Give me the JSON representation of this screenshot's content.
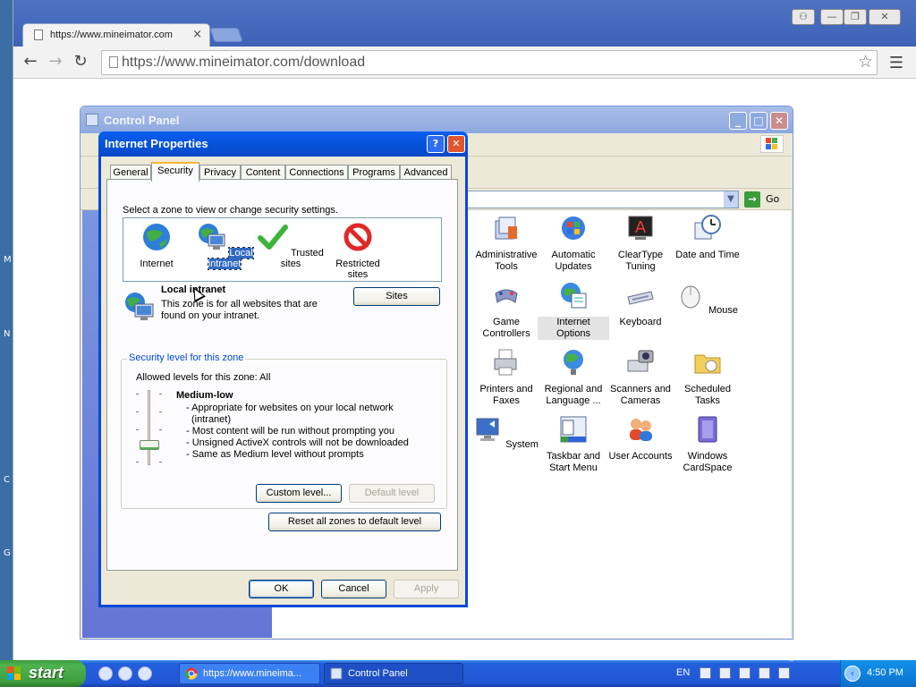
{
  "desktop": {
    "edge_labels": [
      "M",
      "N",
      "C",
      "G"
    ]
  },
  "browser": {
    "tab_title": "https://www.mineimator.com",
    "tab_close": "×",
    "url": "https://www.mineimator.com/download",
    "window_controls": [
      "⚇",
      "—",
      "❐",
      "✕"
    ]
  },
  "control_panel": {
    "title": "Control Panel",
    "address_go": "Go",
    "items": [
      {
        "label": "Administrative Tools",
        "icon": "admin-tools-icon"
      },
      {
        "label": "Automatic Updates",
        "icon": "automatic-updates-icon"
      },
      {
        "label": "ClearType Tuning",
        "icon": "cleartype-icon"
      },
      {
        "label": "Date and Time",
        "icon": "clock-icon"
      },
      {
        "label": "Game Controllers",
        "icon": "gamepad-icon"
      },
      {
        "label": "Internet Options",
        "icon": "internet-options-icon"
      },
      {
        "label": "Keyboard",
        "icon": "keyboard-icon"
      },
      {
        "label": "Mouse",
        "icon": "mouse-icon"
      },
      {
        "label": "Printers and Faxes",
        "icon": "printer-icon"
      },
      {
        "label": "Regional and Language ...",
        "icon": "globe-icon"
      },
      {
        "label": "Scanners and Cameras",
        "icon": "scanner-icon"
      },
      {
        "label": "Scheduled Tasks",
        "icon": "folder-clock-icon"
      },
      {
        "label": "System",
        "icon": "system-icon"
      },
      {
        "label": "Taskbar and Start Menu",
        "icon": "taskbar-icon"
      },
      {
        "label": "User Accounts",
        "icon": "users-icon"
      },
      {
        "label": "Windows CardSpace",
        "icon": "cardspace-icon"
      }
    ]
  },
  "dialog": {
    "title": "Internet Properties",
    "help": "?",
    "close": "✕",
    "tabs": [
      "General",
      "Security",
      "Privacy",
      "Content",
      "Connections",
      "Programs",
      "Advanced"
    ],
    "active_tab": "Security",
    "zone_hint": "Select a zone to view or change security settings.",
    "zones": [
      "Internet",
      "Local intranet",
      "Trusted sites",
      "Restricted sites"
    ],
    "selected_zone": "Local intranet",
    "zone_name": "Local intranet",
    "zone_description": "This zone is for all websites that are found on your intranet.",
    "sites_button": "Sites",
    "security_level_legend": "Security level for this zone",
    "allowed_levels": "Allowed levels for this zone: All",
    "level_name": "Medium-low",
    "level_description": [
      "- Appropriate for websites on your local network",
      "  (intranet)",
      "- Most content will be run without prompting you",
      "- Unsigned ActiveX controls will not be downloaded",
      "- Same as Medium level without prompts"
    ],
    "custom_level_button": "Custom level...",
    "default_level_button": "Default level",
    "reset_all_button": "Reset all zones to default level",
    "ok_button": "OK",
    "cancel_button": "Cancel",
    "apply_button": "Apply"
  },
  "taskbar": {
    "start_label": "start",
    "tasks": [
      "https://www.mineima...",
      "Control Panel"
    ],
    "language": "EN",
    "clock": "4:50 PM"
  }
}
